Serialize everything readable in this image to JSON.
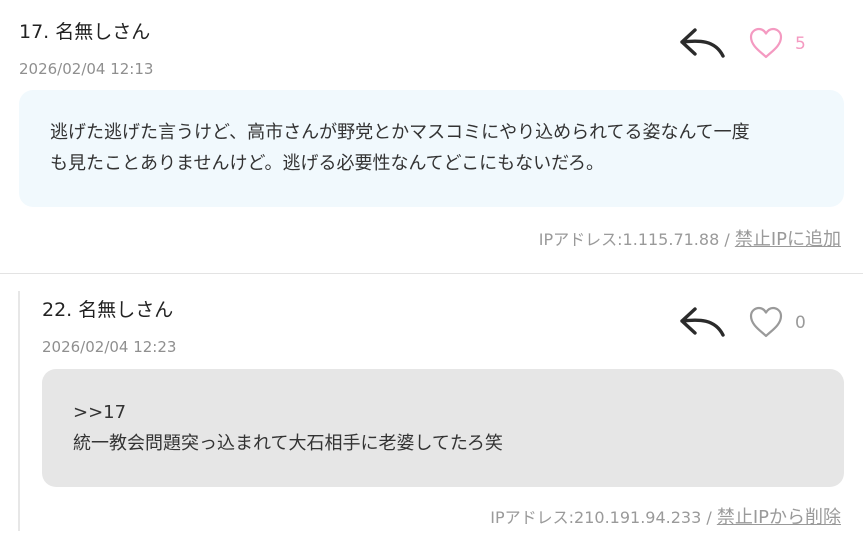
{
  "comments": [
    {
      "name": "17. 名無しさん",
      "date": "2026/02/04 12:13",
      "likes": "5",
      "body_lines": [
        "逃げた逃げた言うけど、高市さんが野党とかマスコミにやり込められてる姿なんて一度",
        "も見たことありませんけど。逃げる必要性なんてどこにもないだろ。"
      ],
      "ip_text": "IPアドレス:1.115.71.88 / ",
      "ip_link": "禁止IPに追加",
      "bubble_color": "#f1f9fd",
      "like_color": "#f49ac1"
    },
    {
      "name": "22. 名無しさん",
      "date": "2026/02/04 12:23",
      "likes": "0",
      "body_lines": [
        ">>17",
        "統一教会問題突っ込まれて大石相手に老婆してたろ笑"
      ],
      "ip_text": "IPアドレス:210.191.94.233 / ",
      "ip_link": "禁止IPから削除",
      "bubble_color": "#e6e6e6",
      "like_color": "#9a9a9a"
    }
  ],
  "icons": {
    "reply": "reply-arrow-icon",
    "like": "heart-outline-icon"
  }
}
